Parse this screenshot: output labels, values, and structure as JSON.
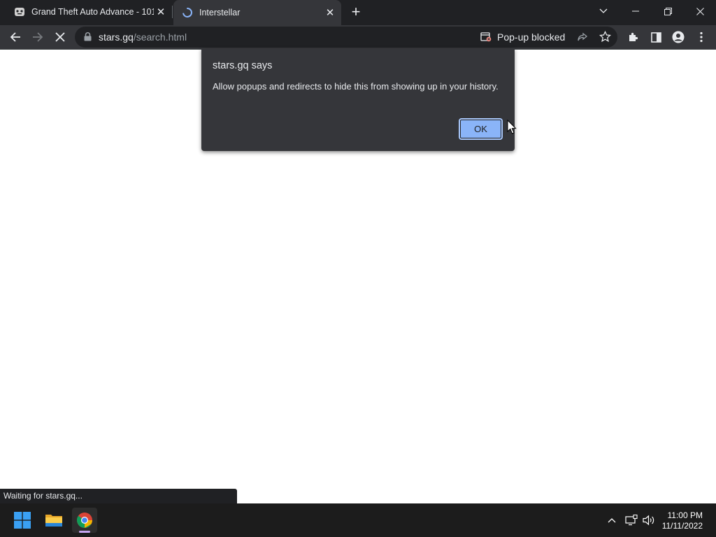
{
  "browser": {
    "tabs": [
      {
        "title": "Grand Theft Auto Advance - 101...",
        "active": false
      },
      {
        "title": "Interstellar",
        "active": true
      }
    ],
    "window_controls": [
      "minimize",
      "restore",
      "close"
    ],
    "address": {
      "host": "stars.gq",
      "path": "/search.html"
    },
    "popup_blocked_label": "Pop-up blocked"
  },
  "dialog": {
    "title": "stars.gq says",
    "message": "Allow popups and redirects to hide this from showing up in your history.",
    "ok_label": "OK"
  },
  "status_bar": {
    "text": "Waiting for stars.gq..."
  },
  "taskbar": {
    "apps": [
      "windows-start-icon",
      "file-explorer-icon",
      "chrome-icon"
    ],
    "time": "11:00 PM",
    "date": "11/11/2022"
  },
  "colors": {
    "tab_strip": "#202124",
    "toolbar": "#35363a",
    "accent": "#8ab4f8",
    "taskbar": "#1c1c1c"
  }
}
